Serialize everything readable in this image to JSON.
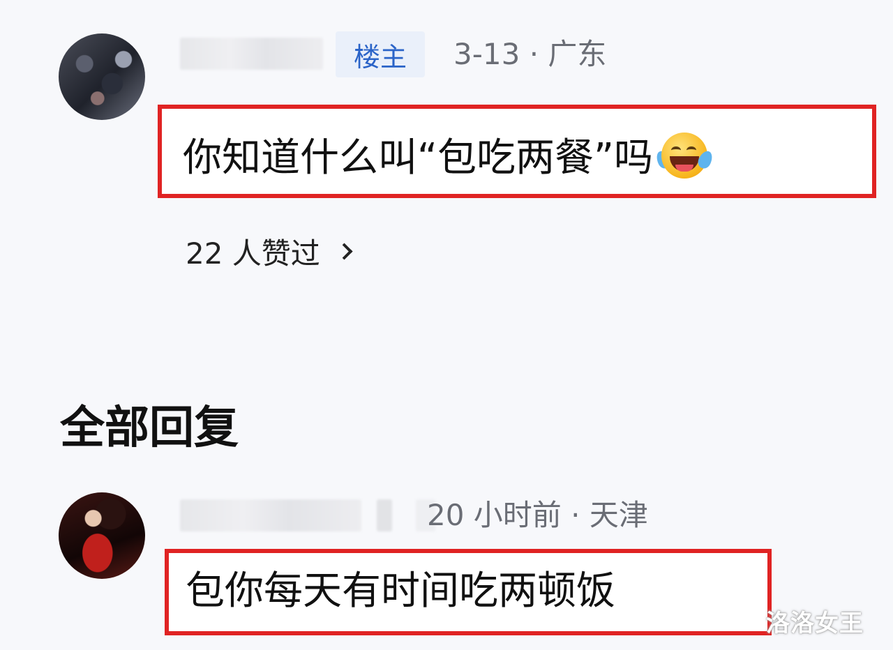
{
  "first_comment": {
    "avatar": "user-avatar",
    "badge": "楼主",
    "date": "3-13",
    "separator": "·",
    "location": "广东",
    "text": "你知道什么叫“包吃两餐”吗",
    "emoji": "laughing-tears-emoji",
    "likes": "22 人赞过",
    "likes_icon": "chevron-right-icon"
  },
  "section": {
    "title": "全部回复"
  },
  "reply": {
    "avatar": "user-avatar",
    "time": "20 小时前",
    "separator": "·",
    "location": "天津",
    "text": "包你每天有时间吃两顿饭"
  },
  "watermark": "洛洛女王",
  "colors": {
    "highlight_border": "#e02323",
    "badge_text": "#2b64c8",
    "badge_bg": "#eaf0fa",
    "meta_text": "#6a6d75",
    "background": "#f7f8fb"
  }
}
